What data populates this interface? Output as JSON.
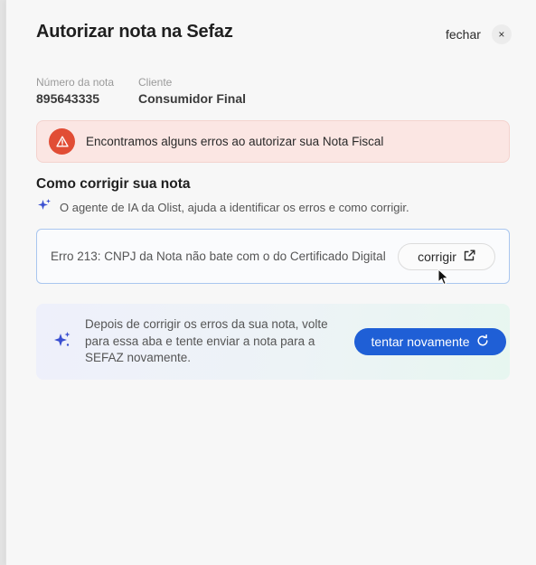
{
  "drawer": {
    "title": "Autorizar nota na Sefaz",
    "close_label": "fechar",
    "close_icon_glyph": "×"
  },
  "invoice": {
    "number_label": "Número da nota",
    "number_value": "895643335",
    "client_label": "Cliente",
    "client_value": "Consumidor Final"
  },
  "alert": {
    "icon": "warning-triangle-icon",
    "color": "#e14d35",
    "message": "Encontramos alguns erros ao autorizar sua Nota Fiscal"
  },
  "fix_section": {
    "title": "Como corrigir sua nota",
    "ai_icon": "sparkles-icon",
    "ai_note": "O agente de IA da Olist, ajuda a identificar os erros e como corrigir.",
    "errors": [
      {
        "text": "Erro 213: CNPJ da Nota não bate com o do Certificado Digital",
        "action_label": "corrigir",
        "action_icon": "external-link-icon"
      }
    ]
  },
  "retry": {
    "icon": "sparkles-icon",
    "text": "Depois de corrigir os erros da sua nota, volte para essa aba e tente enviar a nota para a SEFAZ novamente.",
    "button_label": "tentar novamente",
    "button_icon": "refresh-icon",
    "button_color": "#1f5fd6"
  }
}
